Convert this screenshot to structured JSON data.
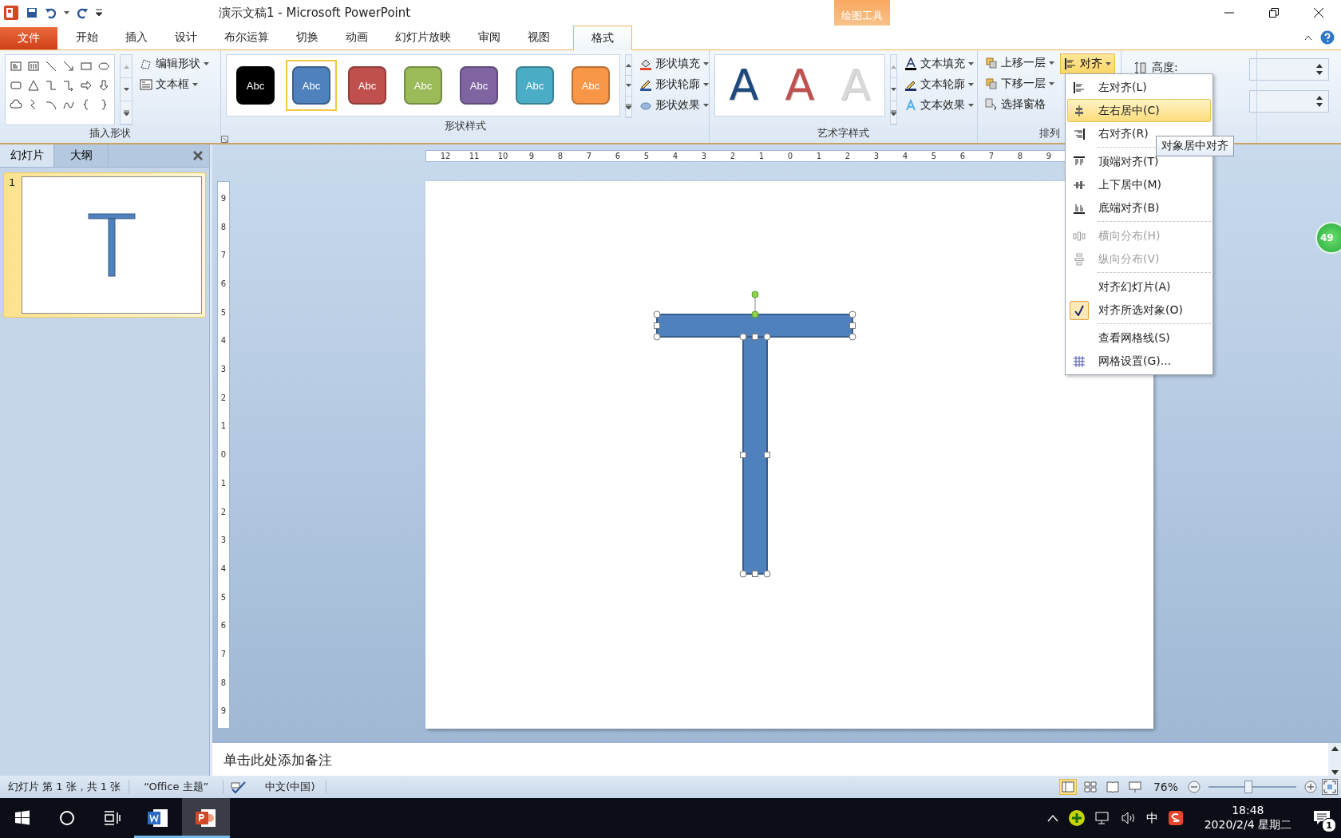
{
  "window": {
    "title": "演示文稿1 - Microsoft PowerPoint",
    "context_tab": "绘图工具"
  },
  "tabs": [
    {
      "label": "文件",
      "kind": "file",
      "selected": false
    },
    {
      "label": "开始",
      "kind": "tab",
      "selected": false
    },
    {
      "label": "插入",
      "kind": "tab",
      "selected": false
    },
    {
      "label": "设计",
      "kind": "tab",
      "selected": false
    },
    {
      "label": "布尔运算",
      "kind": "tab",
      "selected": false
    },
    {
      "label": "切换",
      "kind": "tab",
      "selected": false
    },
    {
      "label": "动画",
      "kind": "tab",
      "selected": false
    },
    {
      "label": "幻灯片放映",
      "kind": "tab",
      "selected": false
    },
    {
      "label": "审阅",
      "kind": "tab",
      "selected": false
    },
    {
      "label": "视图",
      "kind": "tab",
      "selected": false
    },
    {
      "label": "格式",
      "kind": "context",
      "selected": true
    }
  ],
  "ribbon": {
    "insert_shapes": {
      "title": "插入形状",
      "buttons": [
        "编辑形状",
        "文本框"
      ]
    },
    "shape_styles": {
      "title": "形状样式",
      "swatches": [
        {
          "label": "Abc",
          "color": "#000000",
          "selected": false
        },
        {
          "label": "Abc",
          "color": "#4f81bd",
          "selected": true
        },
        {
          "label": "Abc",
          "color": "#c0504d",
          "selected": false
        },
        {
          "label": "Abc",
          "color": "#9bbb59",
          "selected": false
        },
        {
          "label": "Abc",
          "color": "#8064a2",
          "selected": false
        },
        {
          "label": "Abc",
          "color": "#4bacc6",
          "selected": false
        },
        {
          "label": "Abc",
          "color": "#f79646",
          "selected": false
        }
      ],
      "buttons": [
        "形状填充",
        "形状轮廓",
        "形状效果"
      ]
    },
    "wordart_styles": {
      "title": "艺术字样式",
      "samples": [
        {
          "label": "A",
          "color": "#1f497d"
        },
        {
          "label": "A",
          "color": "#c0504d"
        },
        {
          "label": "A",
          "color": "#d9d9d9"
        }
      ],
      "buttons": [
        "文本填充",
        "文本轮廓",
        "文本效果"
      ]
    },
    "arrange": {
      "title": "排列",
      "buttons": [
        "上移一层",
        "下移一层",
        "选择窗格"
      ],
      "align_button": {
        "label": "对齐",
        "open": true
      }
    },
    "size": {
      "height_label": "高度:"
    }
  },
  "align_menu": {
    "items": [
      {
        "kind": "item",
        "label": "左对齐(L)",
        "selected": false,
        "disabled": false,
        "checked": false
      },
      {
        "kind": "item",
        "label": "左右居中(C)",
        "selected": true,
        "disabled": false,
        "checked": false
      },
      {
        "kind": "item",
        "label": "右对齐(R)",
        "selected": false,
        "disabled": false,
        "checked": false
      },
      {
        "kind": "separator"
      },
      {
        "kind": "item",
        "label": "顶端对齐(T)",
        "selected": false,
        "disabled": false,
        "checked": false
      },
      {
        "kind": "item",
        "label": "上下居中(M)",
        "selected": false,
        "disabled": false,
        "checked": false
      },
      {
        "kind": "item",
        "label": "底端对齐(B)",
        "selected": false,
        "disabled": false,
        "checked": false
      },
      {
        "kind": "separator"
      },
      {
        "kind": "item",
        "label": "横向分布(H)",
        "selected": false,
        "disabled": true,
        "checked": false
      },
      {
        "kind": "item",
        "label": "纵向分布(V)",
        "selected": false,
        "disabled": true,
        "checked": false
      },
      {
        "kind": "separator"
      },
      {
        "kind": "item",
        "label": "对齐幻灯片(A)",
        "selected": false,
        "disabled": false,
        "checked": false
      },
      {
        "kind": "item",
        "label": "对齐所选对象(O)",
        "selected": false,
        "disabled": false,
        "checked": true
      },
      {
        "kind": "separator"
      },
      {
        "kind": "item",
        "label": "查看网格线(S)",
        "selected": false,
        "disabled": false,
        "checked": false
      },
      {
        "kind": "item",
        "label": "网格设置(G)...",
        "selected": false,
        "disabled": false,
        "checked": false
      }
    ]
  },
  "tooltip": "对象居中对齐",
  "pane": {
    "tabs": [
      {
        "label": "幻灯片",
        "selected": true
      },
      {
        "label": "大纲",
        "selected": false
      }
    ],
    "slides": [
      {
        "number": "1",
        "selected": true
      }
    ]
  },
  "rulers": {
    "horizontal": [
      "12",
      "11",
      "10",
      "9",
      "8",
      "7",
      "6",
      "5",
      "4",
      "3",
      "2",
      "1",
      "0",
      "1",
      "2",
      "3",
      "4",
      "5",
      "6",
      "7",
      "8",
      "9"
    ],
    "vertical": [
      "9",
      "8",
      "7",
      "6",
      "5",
      "4",
      "3",
      "2",
      "1",
      "0",
      "1",
      "2",
      "3",
      "4",
      "5",
      "6",
      "7",
      "8",
      "9"
    ]
  },
  "notes": {
    "placeholder": "单击此处添加备注"
  },
  "status_bar": {
    "slide_info": "幻灯片 第 1 张，共 1 张",
    "theme": "“Office 主题”",
    "language": "中文(中国)",
    "views": [
      {
        "kind": "normal",
        "selected": true
      },
      {
        "kind": "sorter",
        "selected": false
      },
      {
        "kind": "reading",
        "selected": false
      },
      {
        "kind": "slideshow",
        "selected": false
      }
    ],
    "zoom": "76%",
    "zoom_slider": {
      "level": 0.45
    }
  },
  "badge": "49",
  "taskbar": {
    "apps": [
      {
        "kind": "word",
        "selected": false
      },
      {
        "kind": "powerpoint",
        "selected": true
      }
    ],
    "tray_input": "中",
    "time": "18:48",
    "date": "2020/2/4 星期二",
    "notifications": "1"
  }
}
